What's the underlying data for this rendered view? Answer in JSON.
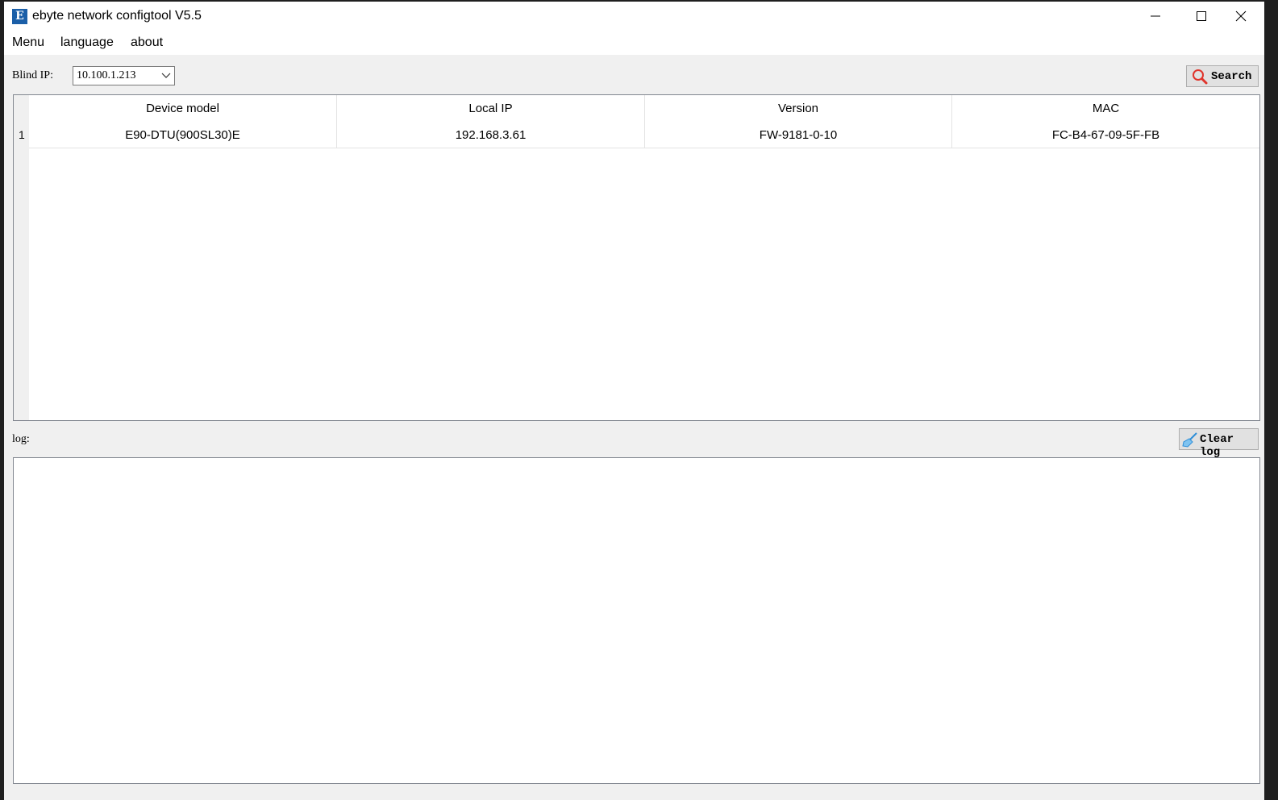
{
  "window": {
    "title": "ebyte network configtool V5.5",
    "icon_letter": "E"
  },
  "menu": {
    "items": [
      "Menu",
      "language",
      "about"
    ]
  },
  "toolbar": {
    "blind_ip_label": "Blind IP:",
    "blind_ip_value": "10.100.1.213",
    "search_label": "Search"
  },
  "table": {
    "columns": [
      "Device model",
      "Local IP",
      "Version",
      "MAC"
    ],
    "rows": [
      {
        "index": "1",
        "cells": [
          "E90-DTU(900SL30)E",
          "192.168.3.61",
          "FW-9181-0-10",
          "FC-B4-67-09-5F-FB"
        ]
      }
    ]
  },
  "log": {
    "label": "log:",
    "clear_label": "Clear log",
    "content": ""
  },
  "colors": {
    "accent": "#1b5fa8",
    "search_icon": "#e0342b",
    "brush_icon": "#2f8fd8"
  }
}
